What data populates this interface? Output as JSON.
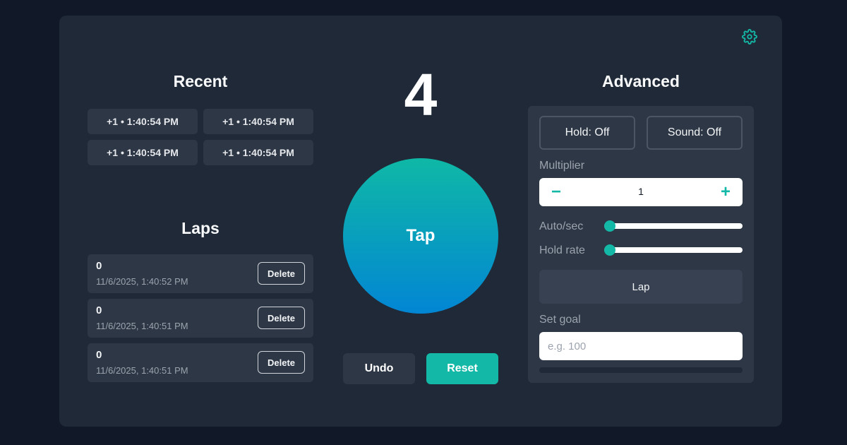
{
  "header": {
    "settings_icon": "gear-icon"
  },
  "recent": {
    "title": "Recent",
    "items": [
      "+1 • 1:40:54 PM",
      "+1 • 1:40:54 PM",
      "+1 • 1:40:54 PM",
      "+1 • 1:40:54 PM"
    ]
  },
  "laps": {
    "title": "Laps",
    "items": [
      {
        "value": "0",
        "time": "11/6/2025, 1:40:52 PM",
        "delete_label": "Delete"
      },
      {
        "value": "0",
        "time": "11/6/2025, 1:40:51 PM",
        "delete_label": "Delete"
      },
      {
        "value": "0",
        "time": "11/6/2025, 1:40:51 PM",
        "delete_label": "Delete"
      }
    ]
  },
  "counter": {
    "count": "4",
    "tap_label": "Tap",
    "undo_label": "Undo",
    "reset_label": "Reset"
  },
  "advanced": {
    "title": "Advanced",
    "hold_label": "Hold: Off",
    "sound_label": "Sound: Off",
    "multiplier_label": "Multiplier",
    "multiplier_minus": "−",
    "multiplier_value": "1",
    "multiplier_plus": "+",
    "autosec_label": "Auto/sec",
    "autosec_value": 0,
    "holdrate_label": "Hold rate",
    "holdrate_value": 0,
    "lap_label": "Lap",
    "goal_label": "Set goal",
    "goal_placeholder": "e.g. 100",
    "goal_value": "",
    "goal_progress": 0
  },
  "colors": {
    "accent": "#14b8a6",
    "background": "#111827",
    "card": "#1f2937",
    "panel": "#2d3745"
  }
}
